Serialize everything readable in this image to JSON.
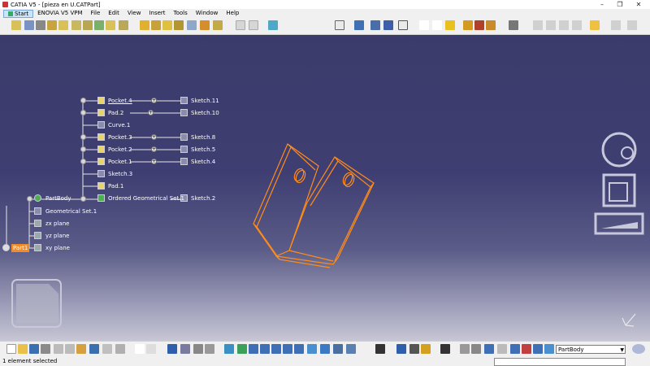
{
  "window": {
    "title": "CATIA V5 - [pieza en U.CATPart]",
    "controls": {
      "minimize": "–",
      "restore": "❐",
      "close": "✕"
    }
  },
  "menu": {
    "items": [
      "Start",
      "ENOVIA V5 VPM",
      "File",
      "Edit",
      "View",
      "Insert",
      "Tools",
      "Window",
      "Help"
    ]
  },
  "tree": {
    "root": "Part1",
    "planes": [
      "xy plane",
      "yz plane",
      "zx plane"
    ],
    "body": "PartBody",
    "geoset": "Geometrical Set.1",
    "features": [
      {
        "label": "Pocket.4",
        "sketch": "Sketch.11"
      },
      {
        "label": "Pad.2",
        "sketch": "Sketch.10"
      },
      {
        "label": "Curve.1",
        "sketch": ""
      },
      {
        "label": "Pocket.3",
        "sketch": "Sketch.8"
      },
      {
        "label": "Pocket.2",
        "sketch": "Sketch.5"
      },
      {
        "label": "Pocket.1",
        "sketch": "Sketch.4"
      },
      {
        "label": "Sketch.3",
        "sketch": ""
      },
      {
        "label": "Pad.1",
        "sketch": ""
      },
      {
        "label": "Ordered Geometrical Set.1",
        "sketch": "Sketch.2"
      }
    ]
  },
  "workspace": {
    "body_selector": "PartBody"
  },
  "status": {
    "message": "1 element selected"
  },
  "colors": {
    "background_top": "#3b3b6b",
    "background_bottom": "#c6c6d4",
    "geometry": "#ff8c1a",
    "tree_text": "#ffffff",
    "selection": "#f28c28"
  }
}
